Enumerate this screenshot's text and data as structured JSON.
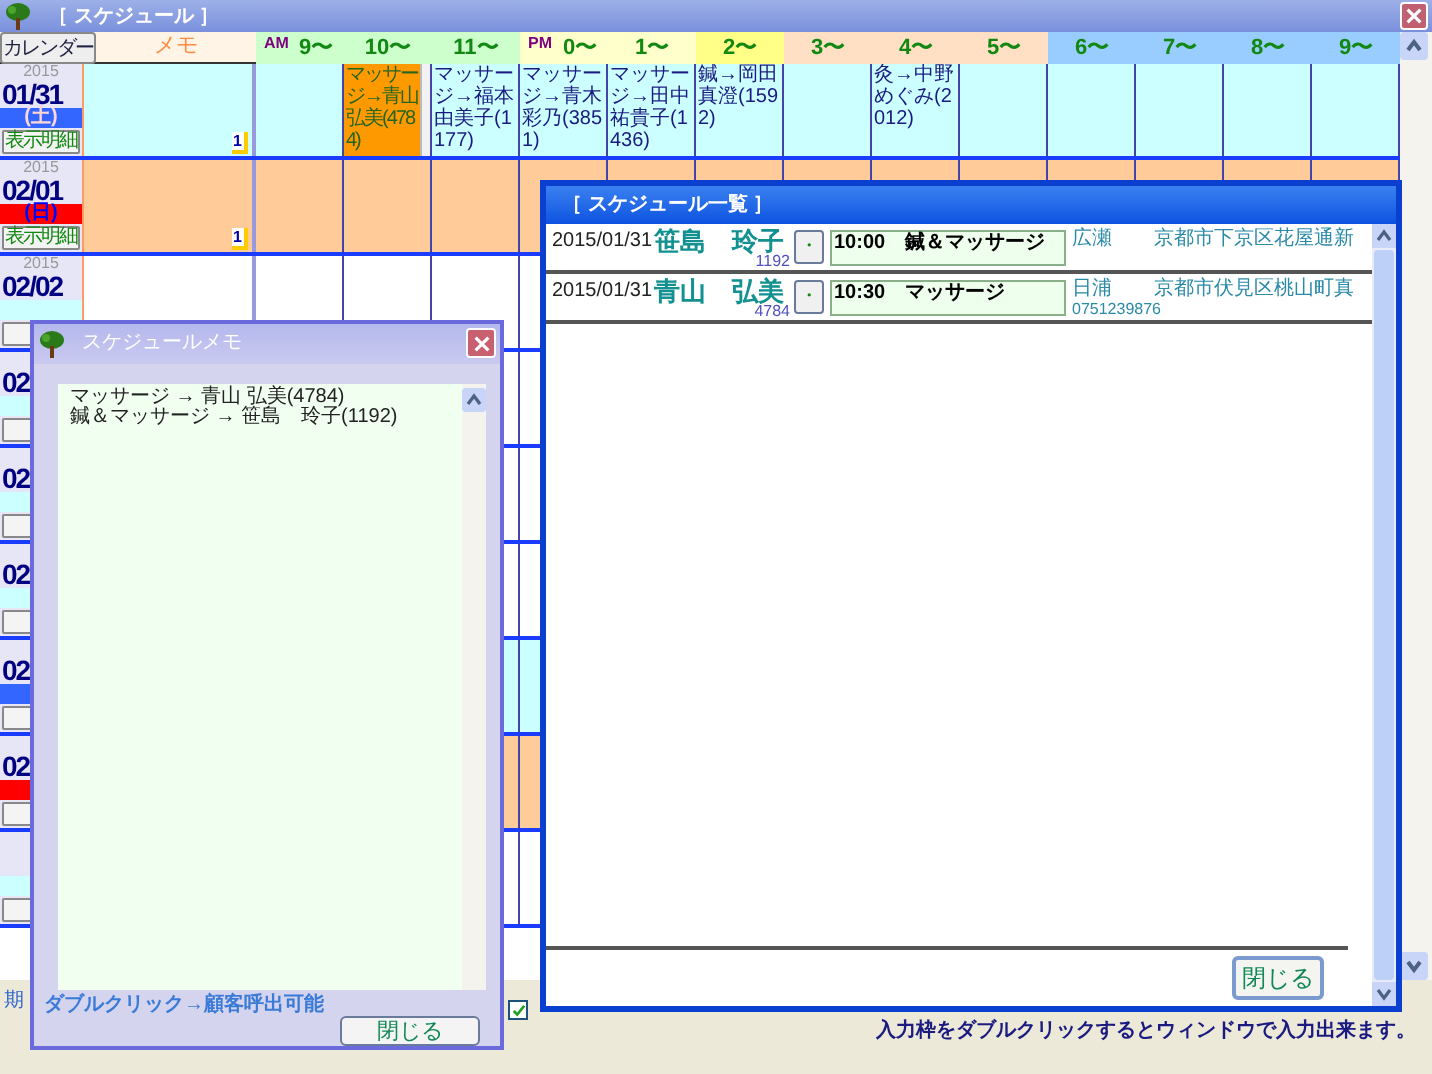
{
  "window": {
    "title": "［ スケジュール ］"
  },
  "header": {
    "calendar_button": "カレンダー",
    "memo_label": "メモ",
    "slots": [
      {
        "label": "9〜",
        "period": "AM",
        "color": "#ccffcc"
      },
      {
        "label": "10〜",
        "color": "#ccffcc"
      },
      {
        "label": "11〜",
        "color": "#ccffcc"
      },
      {
        "label": "0〜",
        "period": "PM",
        "color": "#ffffcc"
      },
      {
        "label": "1〜",
        "color": "#ffffcc"
      },
      {
        "label": "2〜",
        "color": "#ffff88"
      },
      {
        "label": "3〜",
        "color": "#ffe0c4"
      },
      {
        "label": "4〜",
        "color": "#ffe0c4"
      },
      {
        "label": "5〜",
        "color": "#ffe0c4"
      },
      {
        "label": "6〜",
        "color": "#99ccff"
      },
      {
        "label": "7〜",
        "color": "#99ccff"
      },
      {
        "label": "8〜",
        "color": "#99ccff"
      },
      {
        "label": "9〜",
        "color": "#99ccff"
      }
    ]
  },
  "days": [
    {
      "year": "2015",
      "date": "01/31",
      "weekday": "(土)",
      "kind": "saturday",
      "detail_button": "表示明細",
      "memo_badge": "1",
      "cells": [
        null,
        {
          "text": "マッサージ→青山弘美(4784)",
          "highlighted": true
        },
        {
          "text": "マッサージ→福本由美子(1177)",
          "highlighted": false
        },
        {
          "text": "マッサージ→青木彩乃(3851)",
          "highlighted": false
        },
        {
          "text": "マッサージ→田中祐貴子(1436)",
          "highlighted": false
        },
        {
          "text": "鍼→岡田真澄(1592)",
          "highlighted": false
        },
        null,
        {
          "text": "灸→中野めぐみ(2012)",
          "highlighted": false
        },
        null,
        null,
        null,
        null,
        null
      ]
    },
    {
      "year": "2015",
      "date": "02/01",
      "weekday": "(日)",
      "kind": "sunday",
      "detail_button": "表示明細",
      "memo_badge": "1"
    },
    {
      "year": "2015",
      "date": "02/02",
      "kind": "weekday"
    },
    {
      "date": "02",
      "kind": "weekday"
    },
    {
      "date": "02",
      "kind": "weekday"
    },
    {
      "date": "02",
      "kind": "weekday"
    },
    {
      "date": "02",
      "kind": "saturday"
    },
    {
      "date": "02",
      "kind": "sunday"
    },
    {
      "kind": "weekday"
    }
  ],
  "footer": {
    "left_label": "期",
    "checkbox": {
      "checked": true
    },
    "hint": "入力枠をダブルクリックするとウィンドウで入力出来ます。"
  },
  "schedule_list": {
    "title": "［ スケジュール一覧 ］",
    "close_button": "閉じる",
    "rows": [
      {
        "date": "2015/01/31",
        "name": "笹島　玲子",
        "number": "1192",
        "dot": "・",
        "entry": "10:00　鍼＆マッサージ",
        "staff": "広瀬",
        "address": "京都市下京区花屋通新"
      },
      {
        "date": "2015/01/31",
        "name": "青山　弘美",
        "number": "4784",
        "dot": "・",
        "entry": "10:30　マッサージ",
        "staff": "日浦",
        "phone": "0751239876",
        "address": "京都市伏見区桃山町真"
      }
    ]
  },
  "memo_dialog": {
    "title": "スケジュールメモ",
    "text": "マッサージ → 青山 弘美(4784)\n鍼＆マッサージ → 笹島　玲子(1192)",
    "hint": "ダブルクリック→顧客呼出可能",
    "close_button": "閉じる"
  }
}
